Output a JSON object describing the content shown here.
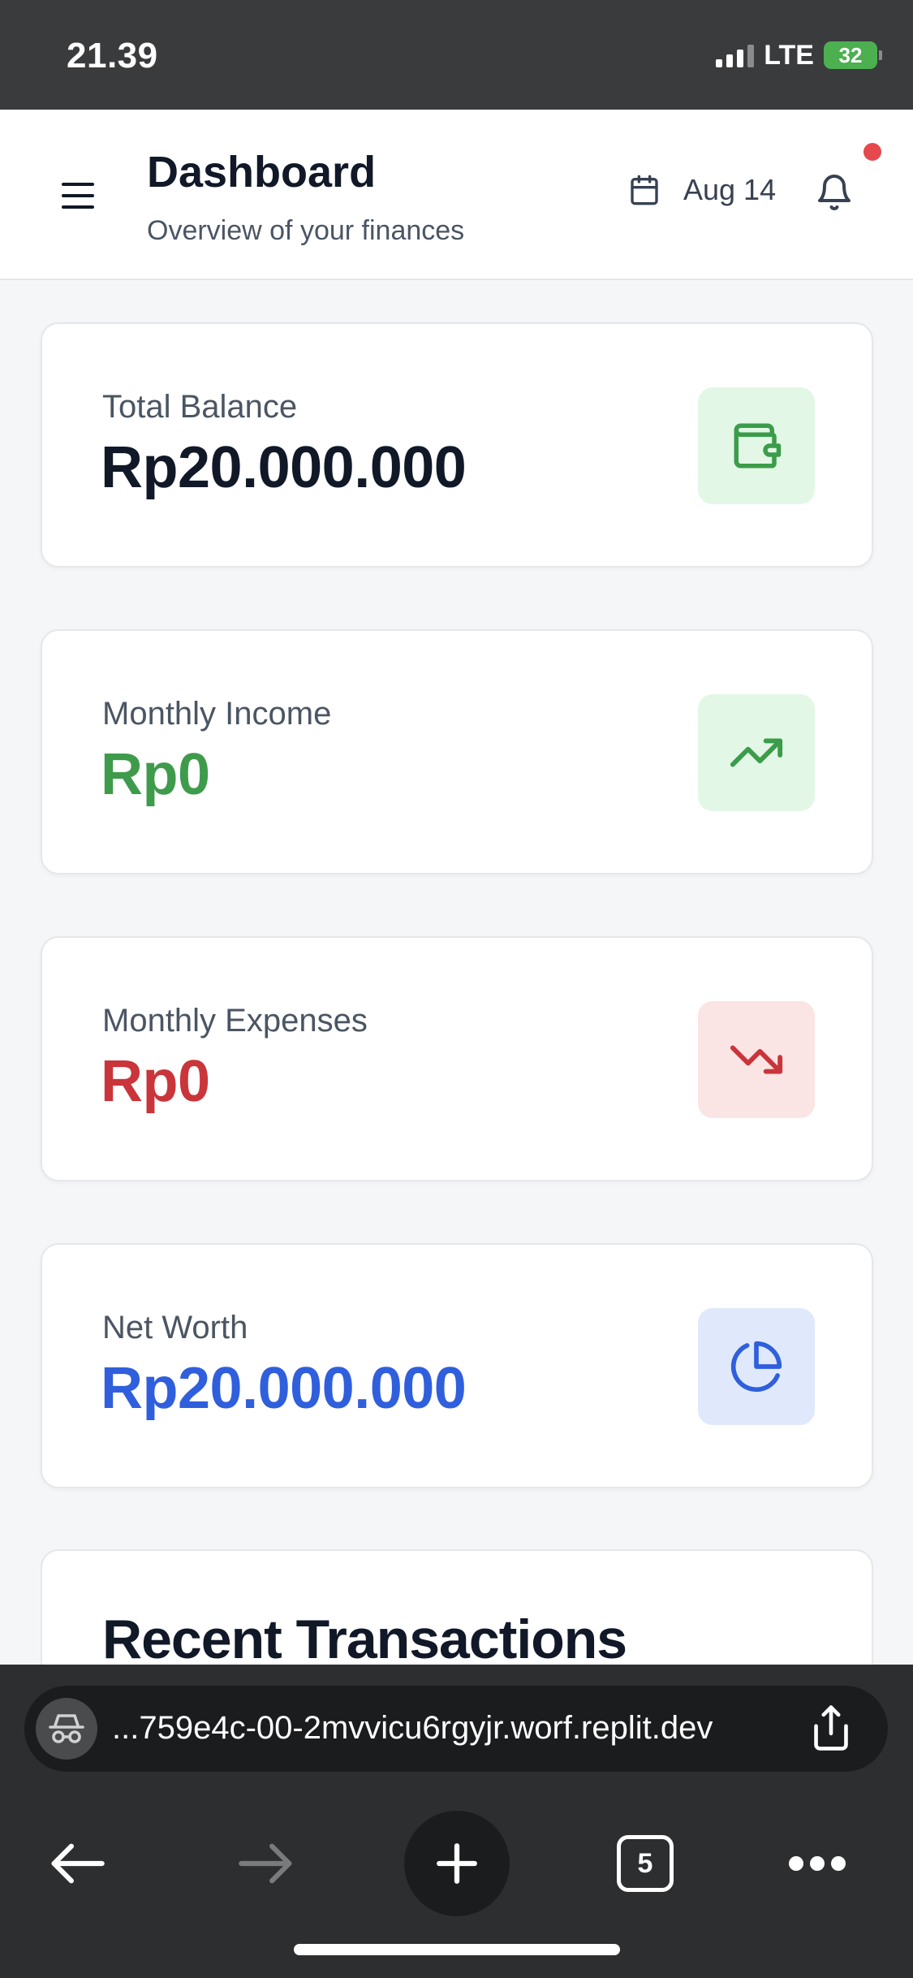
{
  "status_bar": {
    "time": "21.39",
    "network": "LTE",
    "battery": "32"
  },
  "header": {
    "title": "Dashboard",
    "subtitle": "Overview of your finances",
    "date": "Aug 14"
  },
  "cards": [
    {
      "label": "Total Balance",
      "value": "Rp20.000.000",
      "value_color": "#111827",
      "icon": "wallet-icon",
      "icon_bg": "#e3f7e6",
      "icon_color": "#3b9c4a"
    },
    {
      "label": "Monthly Income",
      "value": "Rp0",
      "value_color": "#3f9b4c",
      "icon": "trending-up-icon",
      "icon_bg": "#e3f7e6",
      "icon_color": "#3b9c4a"
    },
    {
      "label": "Monthly Expenses",
      "value": "Rp0",
      "value_color": "#c9353a",
      "icon": "trending-down-icon",
      "icon_bg": "#fbe4e4",
      "icon_color": "#c9353a"
    },
    {
      "label": "Net Worth",
      "value": "Rp20.000.000",
      "value_color": "#2f5fdc",
      "icon": "pie-chart-icon",
      "icon_bg": "#e0e9fb",
      "icon_color": "#2f5fdc"
    }
  ],
  "recent": {
    "title": "Recent Transactions"
  },
  "browser": {
    "url": "...759e4c-00-2mvvicu6rgyjr.worf.replit.dev",
    "tab_count": "5"
  }
}
